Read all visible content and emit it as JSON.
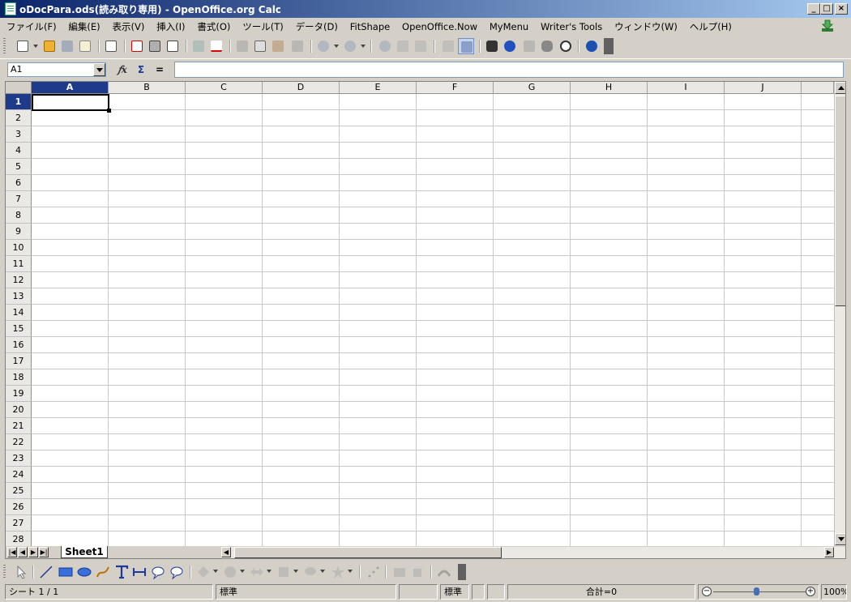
{
  "window": {
    "title": "oDocPara.ods(読み取り専用) - OpenOffice.org  Calc",
    "controls": [
      "_",
      "□",
      "×"
    ]
  },
  "menu": {
    "items": [
      "ファイル(F)",
      "編集(E)",
      "表示(V)",
      "挿入(I)",
      "書式(O)",
      "ツール(T)",
      "データ(D)",
      "FitShape",
      "OpenOffice.Now",
      "MyMenu",
      "Writer's Tools",
      "ウィンドウ(W)",
      "ヘルプ(H)"
    ]
  },
  "toolbar": {
    "icons": [
      "new-document-icon",
      "open-folder-icon",
      "save-icon",
      "email-icon",
      "edit-file-icon",
      "export-pdf-icon",
      "print-icon",
      "page-preview-icon",
      "spellcheck-icon",
      "auto-spellcheck-icon",
      "cut-icon",
      "copy-icon",
      "paste-icon",
      "clone-format-icon",
      "undo-icon",
      "redo-icon",
      "hyperlink-icon",
      "sort-ascending-icon",
      "sort-descending-icon",
      "chart-icon",
      "draw-functions-icon",
      "find-replace-icon",
      "navigator-icon",
      "gallery-icon",
      "data-sources-icon",
      "zoom-icon",
      "help-icon"
    ]
  },
  "formula": {
    "name_box": "A1",
    "fx": "𝑓x",
    "sum": "Σ",
    "equals": "=",
    "content": ""
  },
  "sheet": {
    "columns": [
      "A",
      "B",
      "C",
      "D",
      "E",
      "F",
      "G",
      "H",
      "I",
      "J"
    ],
    "rows": [
      "1",
      "2",
      "3",
      "4",
      "5",
      "6",
      "7",
      "8",
      "9",
      "10",
      "11",
      "12",
      "13",
      "14",
      "15",
      "16",
      "17",
      "18",
      "19",
      "20",
      "21",
      "22",
      "23",
      "24",
      "25",
      "26",
      "27",
      "28"
    ],
    "selected_cell": "A1",
    "tab_name": "Sheet1"
  },
  "statusbar": {
    "sheet_info": "シート 1 / 1",
    "page_style": "標準",
    "style2": "標準",
    "sum": "合計=0",
    "zoom": "100%",
    "zoom_level": 1.0
  },
  "colors": {
    "title_bar": "#0a246a",
    "selected_header": "#1e3a8a",
    "chrome": "#d4d0c8"
  }
}
